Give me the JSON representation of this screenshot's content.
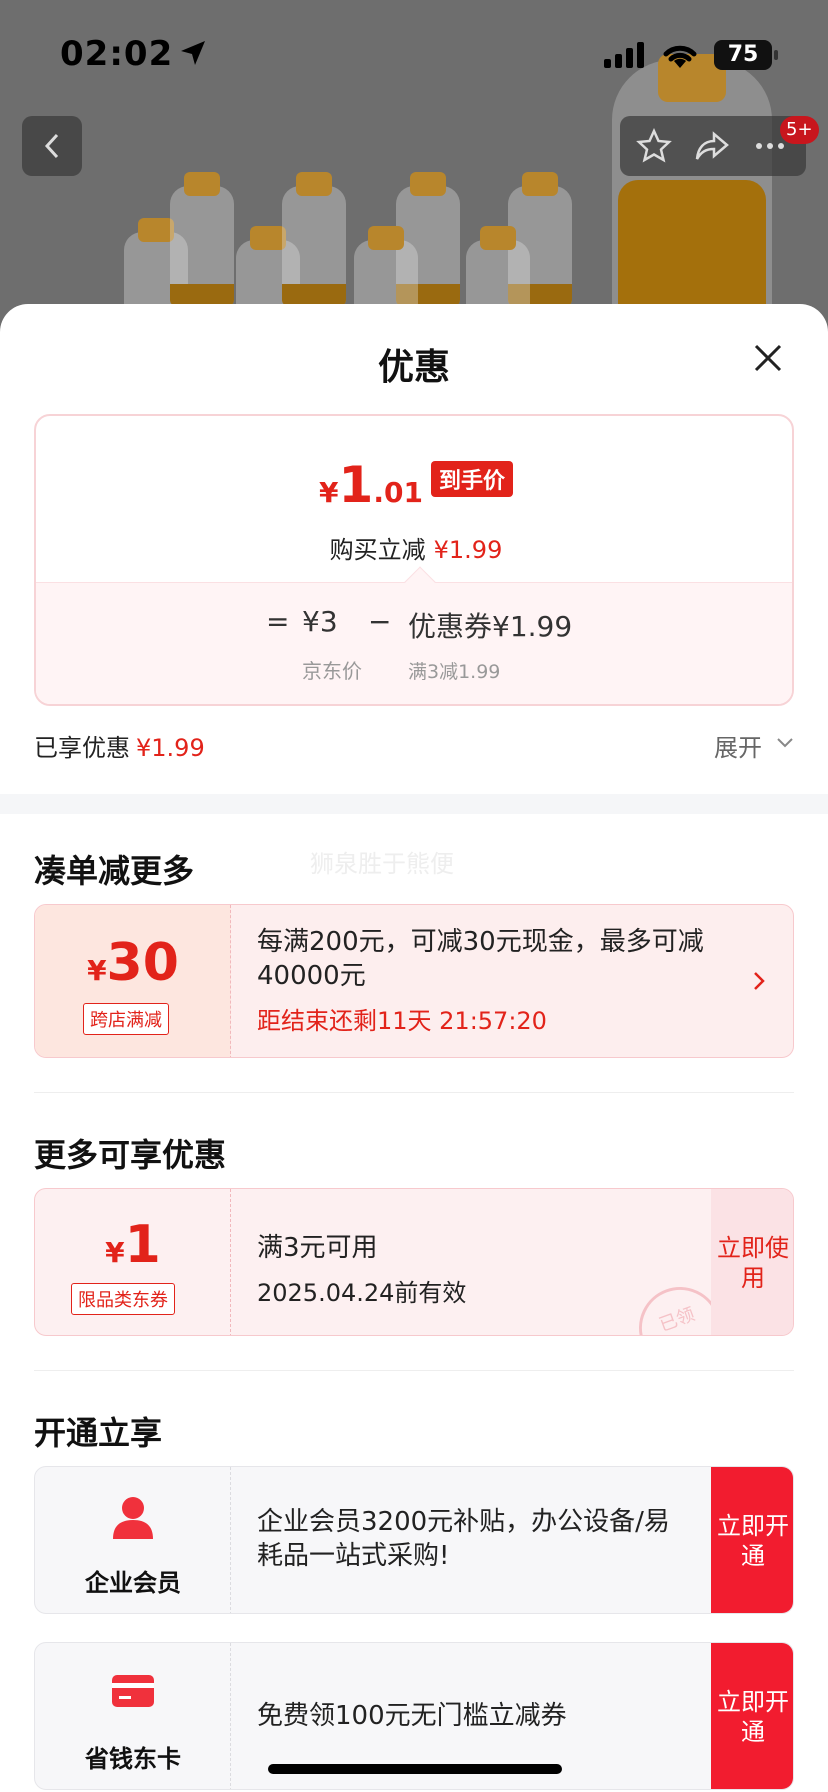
{
  "status_bar": {
    "time": "02:02",
    "battery": "75"
  },
  "background": {
    "notification_count": "5+"
  },
  "sheet": {
    "title": "优惠",
    "price_summary": {
      "currency": "¥",
      "final_int": "1",
      "final_dec": ".01",
      "final_tag": "到手价",
      "reduce_label": "购买立减",
      "reduce_value": "¥1.99",
      "equals": "=",
      "jd_price": "¥3",
      "jd_label": "京东价",
      "minus": "−",
      "coupon_value": "优惠券¥1.99",
      "coupon_rule": "满3减1.99"
    },
    "enjoyed": {
      "label": "已享优惠",
      "value": "¥1.99",
      "expand": "展开"
    },
    "combine": {
      "title": "凑单减更多",
      "watermark": "狮泉胜于熊便",
      "promo": {
        "currency": "¥",
        "amount": "30",
        "tag": "跨店满减",
        "text": "每满200元，可减30元现金，最多可减40000元",
        "countdown": "距结束还剩11天 21:57:20"
      }
    },
    "more": {
      "title": "更多可享优惠",
      "coupon": {
        "currency": "¥",
        "amount": "1",
        "tag": "限品类东券",
        "condition": "满3元可用",
        "validity": "2025.04.24前有效",
        "button": "立即使用",
        "stamp": "已领"
      }
    },
    "open": {
      "title": "开通立享",
      "items": [
        {
          "name": "企业会员",
          "text": "企业会员3200元补贴，办公设备/易耗品一站式采购!",
          "button": "立即开通",
          "icon": "person-icon"
        },
        {
          "name": "省钱东卡",
          "text": "免费领100元无门槛立减券",
          "button": "立即开通",
          "icon": "card-icon"
        }
      ]
    }
  },
  "colors": {
    "accent": "#e2231a",
    "button_red": "#f21c2f"
  }
}
